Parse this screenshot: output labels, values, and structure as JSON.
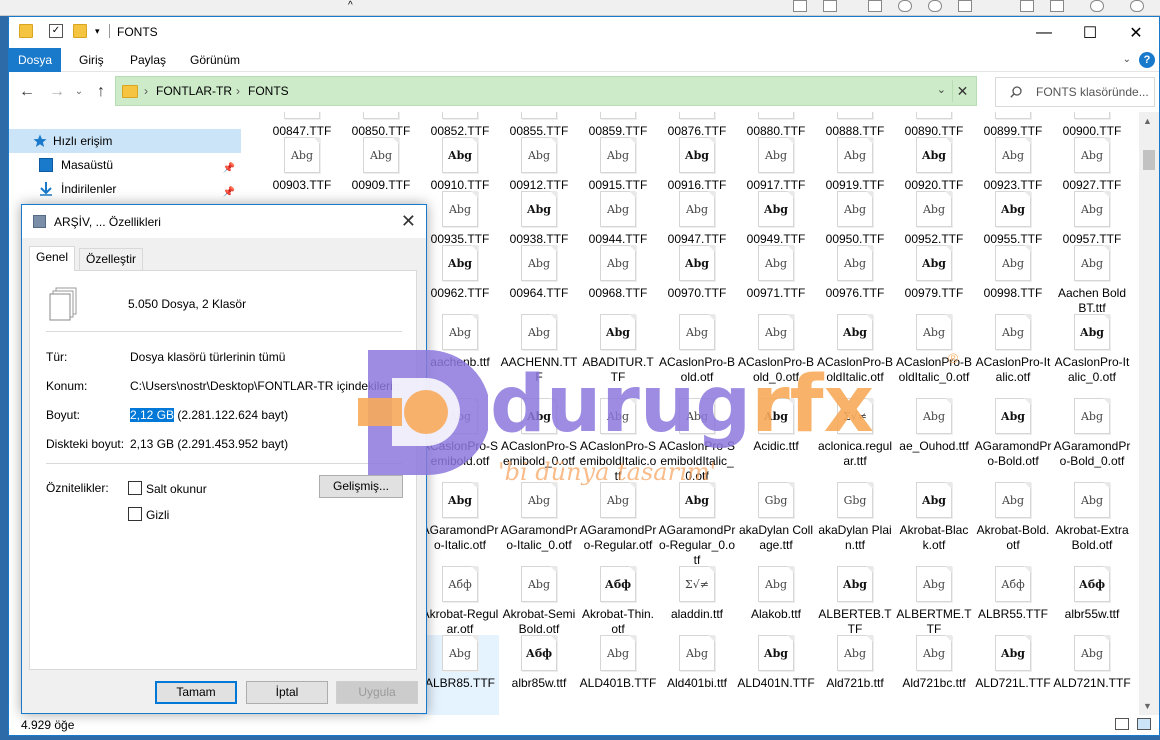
{
  "window": {
    "title": "FONTS",
    "minimize_glyph": "—",
    "maximize_glyph": "☐",
    "close_glyph": "✕"
  },
  "ribbon": {
    "tabs": [
      "Dosya",
      "Giriş",
      "Paylaş",
      "Görünüm"
    ],
    "help_glyph": "?"
  },
  "address": {
    "crumbs": [
      "FONTLAR-TR",
      "FONTS"
    ],
    "separator": "›",
    "search_placeholder": "FONTS klasöründe..."
  },
  "nav": {
    "back": "←",
    "forward": "→",
    "recent": "⌄",
    "up": "↑",
    "items": [
      {
        "label": "Hızlı erişim",
        "icon": "star-icon",
        "pinned": false
      },
      {
        "label": "Masaüstü",
        "icon": "desktop-icon",
        "pinned": true
      },
      {
        "label": "İndirilenler",
        "icon": "download-icon",
        "pinned": true
      }
    ]
  },
  "files": {
    "row0": [
      "00847.TTF",
      "00850.TTF",
      "00852.TTF",
      "00855.TTF",
      "00859.TTF",
      "00876.TTF",
      "00880.TTF",
      "00888.TTF",
      "00890.TTF",
      "00899.TTF",
      "00900.TTF"
    ],
    "row1": [
      "00903.TTF",
      "00909.TTF",
      "00910.TTF",
      "00912.TTF",
      "00915.TTF",
      "00916.TTF",
      "00917.TTF",
      "00919.TTF",
      "00920.TTF",
      "00923.TTF",
      "00927.TTF"
    ],
    "row2": [
      "00935.TTF",
      "00938.TTF",
      "00944.TTF",
      "00947.TTF",
      "00949.TTF",
      "00950.TTF",
      "00952.TTF",
      "00955.TTF",
      "00957.TTF"
    ],
    "row3": [
      "00962.TTF",
      "00964.TTF",
      "00968.TTF",
      "00970.TTF",
      "00971.TTF",
      "00976.TTF",
      "00979.TTF",
      "00998.TTF",
      "Aachen Bold BT.ttf"
    ],
    "row4": [
      "aachenb.ttf",
      "AACHENN.TTF",
      "ABADITUR.TTF",
      "ACaslonPro-Bold.otf",
      "ACaslonPro-Bold_0.otf",
      "ACaslonPro-BoldItalic.otf",
      "ACaslonPro-BoldItalic_0.otf",
      "ACaslonPro-Italic.otf",
      "ACaslonPro-Italic_0.otf"
    ],
    "row5": [
      "ACaslonPro-Semibold.otf",
      "ACaslonPro-Semibold_0.otf",
      "ACaslonPro-SemiboldItalic.otf",
      "ACaslonPro-SemiboldItalic_0.otf",
      "Acidic.ttf",
      "aclonica.regular.ttf",
      "ae_Ouhod.ttf",
      "AGaramondPro-Bold.otf",
      "AGaramondPro-Bold_0.otf"
    ],
    "row6": [
      "AGaramondPro-Italic.otf",
      "AGaramondPro-Italic_0.otf",
      "AGaramondPro-Regular.otf",
      "AGaramondPro-Regular_0.otf",
      "akaDylan Collage.ttf",
      "akaDylan Plain.ttf",
      "Akrobat-Black.otf",
      "Akrobat-Bold.otf",
      "Akrobat-ExtraBold.otf"
    ],
    "row7": [
      "Akrobat-Regular.otf",
      "Akrobat-SemiBold.otf",
      "Akrobat-Thin.otf",
      "aladdin.ttf",
      "Alakob.ttf",
      "ALBERTEB.TTF",
      "ALBERTME.TTF",
      "ALBR55.TTF",
      "albr55w.ttf"
    ],
    "row8": [
      "ALBR85.TTF",
      "albr85w.ttf",
      "ALD401B.TTF",
      "Ald401bi.ttf",
      "ALD401N.TTF",
      "Ald721b.ttf",
      "Ald721bc.ttf",
      "ALD721L.TTF",
      "ALD721N.TTF"
    ]
  },
  "thumb_labels": {
    "abg": "Abg",
    "dylan": "Gbg",
    "cyr": "Абф",
    "sym": "Σ√≠"
  },
  "status": {
    "count": "4.929 öğe"
  },
  "dialog": {
    "title": "ARŞİV, ... Özellikleri",
    "close_glyph": "✕",
    "tabs": [
      "Genel",
      "Özelleştir"
    ],
    "summary": "5.050 Dosya, 2 Klasör",
    "rows": [
      {
        "label": "Tür:",
        "value": "Dosya klasörü türlerinin tümü"
      },
      {
        "label": "Konum:",
        "value": "C:\\Users\\nostr\\Desktop\\FONTLAR-TR içindekilerin t"
      },
      {
        "label": "Boyut:",
        "value_sel": "2,12 GB",
        "value_rest": " (2.281.122.624 bayt)"
      },
      {
        "label": "Diskteki boyut:",
        "value": "2,13 GB (2.291.453.952 bayt)"
      }
    ],
    "attributes_label": "Öznitelikler:",
    "readonly_label": "Salt okunur",
    "hidden_label": "Gizli",
    "advanced_button": "Gelişmiş...",
    "ok_button": "Tamam",
    "cancel_button": "İptal",
    "apply_button": "Uygula"
  },
  "watermark": {
    "brand_a": "durug",
    "brand_b": "rfx",
    "reg": "®",
    "tagline": "'bi dünya tasarım'"
  },
  "colors": {
    "accent": "#1979ca",
    "address_bg": "#cdebc9",
    "selection": "#0078d7",
    "watermark_purple": "#8c78dc",
    "watermark_orange": "#f7aa5a"
  }
}
